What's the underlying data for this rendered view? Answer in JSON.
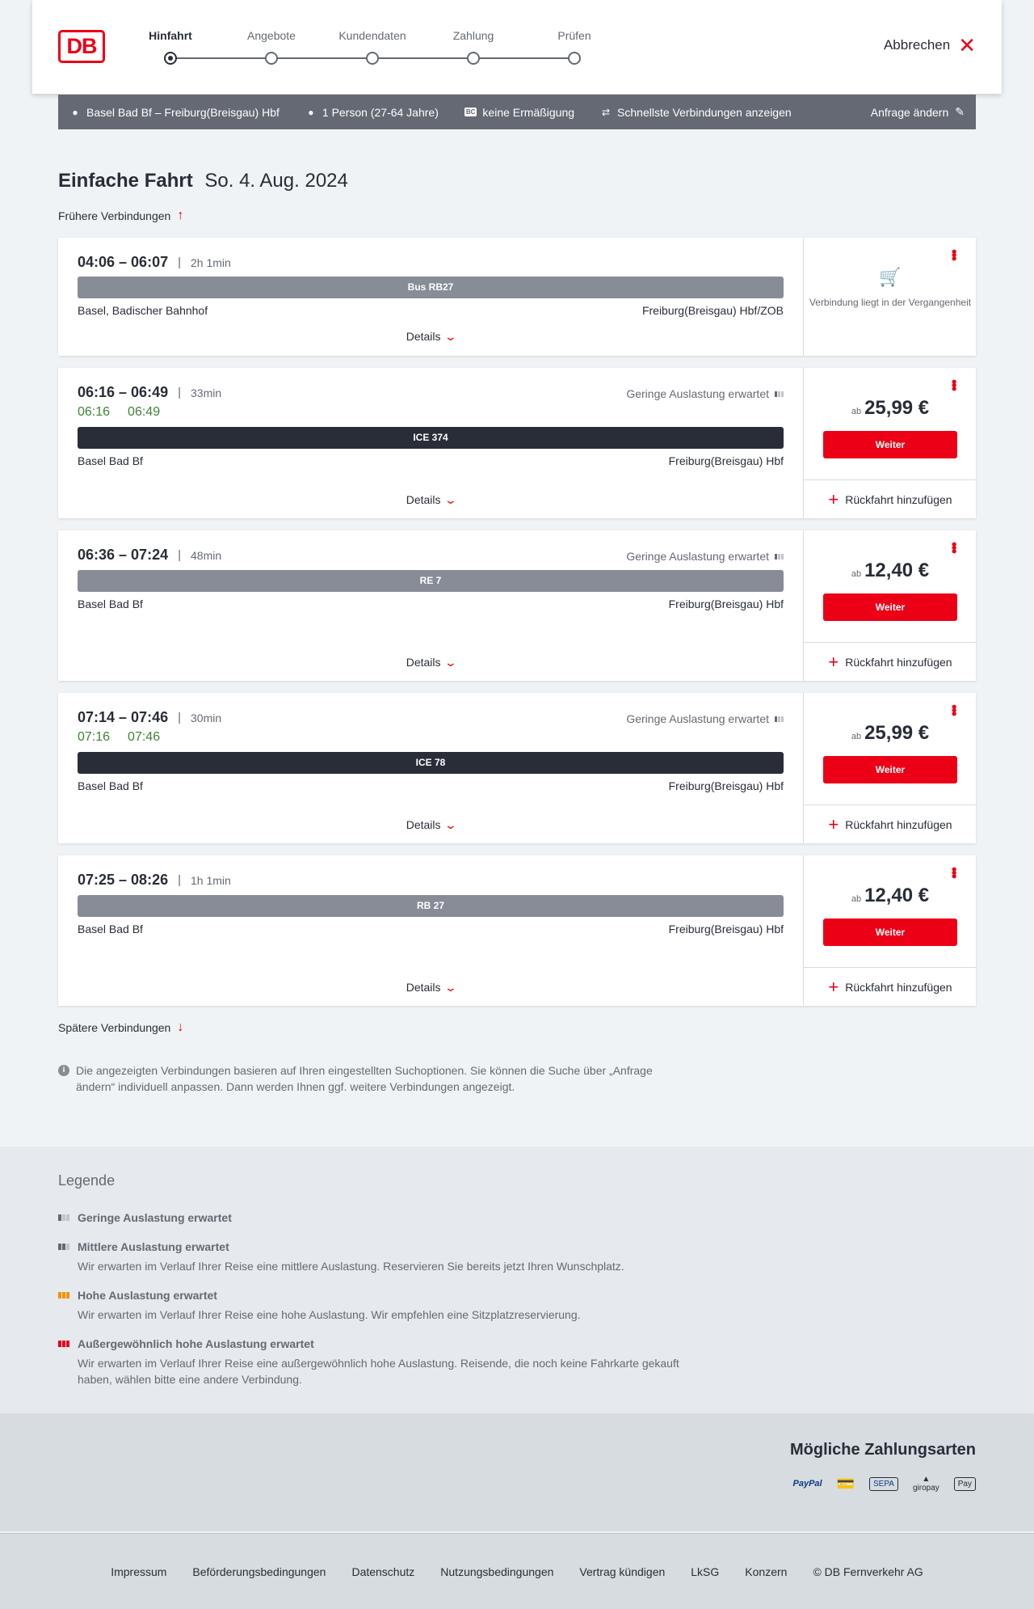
{
  "header": {
    "logo_text": "DB",
    "steps": [
      "Hinfahrt",
      "Angebote",
      "Kundendaten",
      "Zahlung",
      "Prüfen"
    ],
    "active_step": 0,
    "cancel_label": "Abbrechen"
  },
  "searchbar": {
    "route": "Basel Bad Bf – Freiburg(Breisgau) Hbf",
    "persons": "1 Person (27-64 Jahre)",
    "bc_badge": "BC",
    "discount": "keine Ermäßigung",
    "fastest": "Schnellste Verbindungen anzeigen",
    "change_label": "Anfrage ändern"
  },
  "title": {
    "main": "Einfache Fahrt",
    "date": "So. 4. Aug. 2024"
  },
  "earlier_label": "Frühere Verbindungen",
  "later_label": "Spätere Verbindungen",
  "details_label": "Details",
  "weiter_label": "Weiter",
  "rueckfahrt_label": "Rückfahrt hinzufügen",
  "price_prefix": "ab",
  "connections": [
    {
      "time": "04:06 – 06:07",
      "duration": "2h 1min",
      "train": "Bus RB27",
      "train_style": "gray",
      "from": "Basel, Badischer Bahnhof",
      "to": "Freiburg(Breisgau) Hbf/ZOB",
      "past_text": "Verbindung liegt in der Vergangenheit"
    },
    {
      "time": "06:16 – 06:49",
      "duration": "33min",
      "realtime_dep": "06:16",
      "realtime_arr": "06:49",
      "occupancy": "Geringe Auslastung erwartet",
      "train": "ICE 374",
      "train_style": "dark",
      "from": "Basel Bad Bf",
      "to": "Freiburg(Breisgau) Hbf",
      "price": "25,99 €"
    },
    {
      "time": "06:36 – 07:24",
      "duration": "48min",
      "occupancy": "Geringe Auslastung erwartet",
      "train": "RE 7",
      "train_style": "gray",
      "from": "Basel Bad Bf",
      "to": "Freiburg(Breisgau) Hbf",
      "price": "12,40 €"
    },
    {
      "time": "07:14 – 07:46",
      "duration": "30min",
      "realtime_dep": "07:16",
      "realtime_arr": "07:46",
      "occupancy": "Geringe Auslastung erwartet",
      "train": "ICE 78",
      "train_style": "dark",
      "from": "Basel Bad Bf",
      "to": "Freiburg(Breisgau) Hbf",
      "price": "25,99 €"
    },
    {
      "time": "07:25 – 08:26",
      "duration": "1h 1min",
      "train": "RB 27",
      "train_style": "gray",
      "from": "Basel Bad Bf",
      "to": "Freiburg(Breisgau) Hbf",
      "price": "12,40 €"
    }
  ],
  "info_text": "Die angezeigten Verbindungen basieren auf Ihren eingestellten Suchoptionen. Sie können die Suche über „Anfrage ändern“ individuell anpassen. Dann werden Ihnen ggf. weitere Verbindungen angezeigt.",
  "legend": {
    "title": "Legende",
    "items": [
      {
        "title": "Geringe Auslastung erwartet",
        "desc": "",
        "level": 1,
        "color": "#646973"
      },
      {
        "title": "Mittlere Auslastung erwartet",
        "desc": "Wir erwarten im Verlauf Ihrer Reise eine mittlere Auslastung. Reservieren Sie bereits jetzt Ihren Wunschplatz.",
        "level": 2,
        "color": "#646973"
      },
      {
        "title": "Hohe Auslastung erwartet",
        "desc": "Wir erwarten im Verlauf Ihrer Reise eine hohe Auslastung. Wir empfehlen eine Sitzplatzreservierung.",
        "level": 3,
        "color": "#f39200"
      },
      {
        "title": "Außergewöhnlich hohe Auslastung erwartet",
        "desc": "Wir erwarten im Verlauf Ihrer Reise eine außergewöhnlich hohe Auslastung. Reisende, die noch keine Fahrkarte gekauft haben, wählen bitte eine andere Verbindung.",
        "level": 4,
        "color": "#ec0016"
      }
    ]
  },
  "payment": {
    "title": "Mögliche Zahlungsarten",
    "methods": [
      "PayPal",
      "Kreditkarte",
      "SEPA",
      "giropay",
      "Apple Pay"
    ],
    "paypal_label": "PayPal",
    "sepa_label": "SEPA",
    "giropay_label": "giropay",
    "applepay_label": "Pay"
  },
  "footer": {
    "links": [
      "Impressum",
      "Beförderungsbedingungen",
      "Datenschutz",
      "Nutzungsbedingungen",
      "Vertrag kündigen",
      "LkSG",
      "Konzern",
      "© DB Fernverkehr AG"
    ]
  },
  "colors": {
    "accent": "#ec0016",
    "realtime": "#408335",
    "dark": "#282d37",
    "bar_gray": "#878c96"
  }
}
